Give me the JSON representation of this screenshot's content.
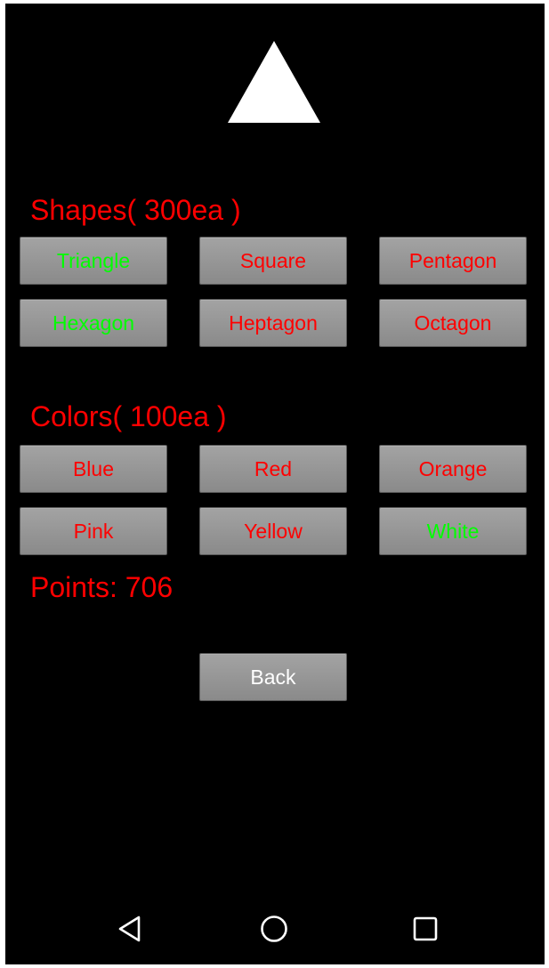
{
  "preview": {
    "shape": "triangle",
    "color": "#ffffff"
  },
  "shapes": {
    "title": "Shapes( 300ea )",
    "buttons": [
      {
        "label": "Triangle",
        "owned": true
      },
      {
        "label": "Square",
        "owned": false
      },
      {
        "label": "Pentagon",
        "owned": false
      },
      {
        "label": "Hexagon",
        "owned": true
      },
      {
        "label": "Heptagon",
        "owned": false
      },
      {
        "label": "Octagon",
        "owned": false
      }
    ]
  },
  "colors": {
    "title": "Colors( 100ea )",
    "buttons": [
      {
        "label": "Blue",
        "owned": false
      },
      {
        "label": "Red",
        "owned": false
      },
      {
        "label": "Orange",
        "owned": false
      },
      {
        "label": "Pink",
        "owned": false
      },
      {
        "label": "Yellow",
        "owned": false
      },
      {
        "label": "White",
        "owned": true
      }
    ]
  },
  "points": {
    "text": "Points: 706"
  },
  "back": {
    "label": "Back"
  },
  "palette": {
    "owned": "#00ff00",
    "not_owned": "#ff0000",
    "background": "#000000",
    "button": "#999999"
  },
  "navbar": {
    "icons": [
      "back-triangle-icon",
      "home-circle-icon",
      "recents-square-icon"
    ]
  }
}
